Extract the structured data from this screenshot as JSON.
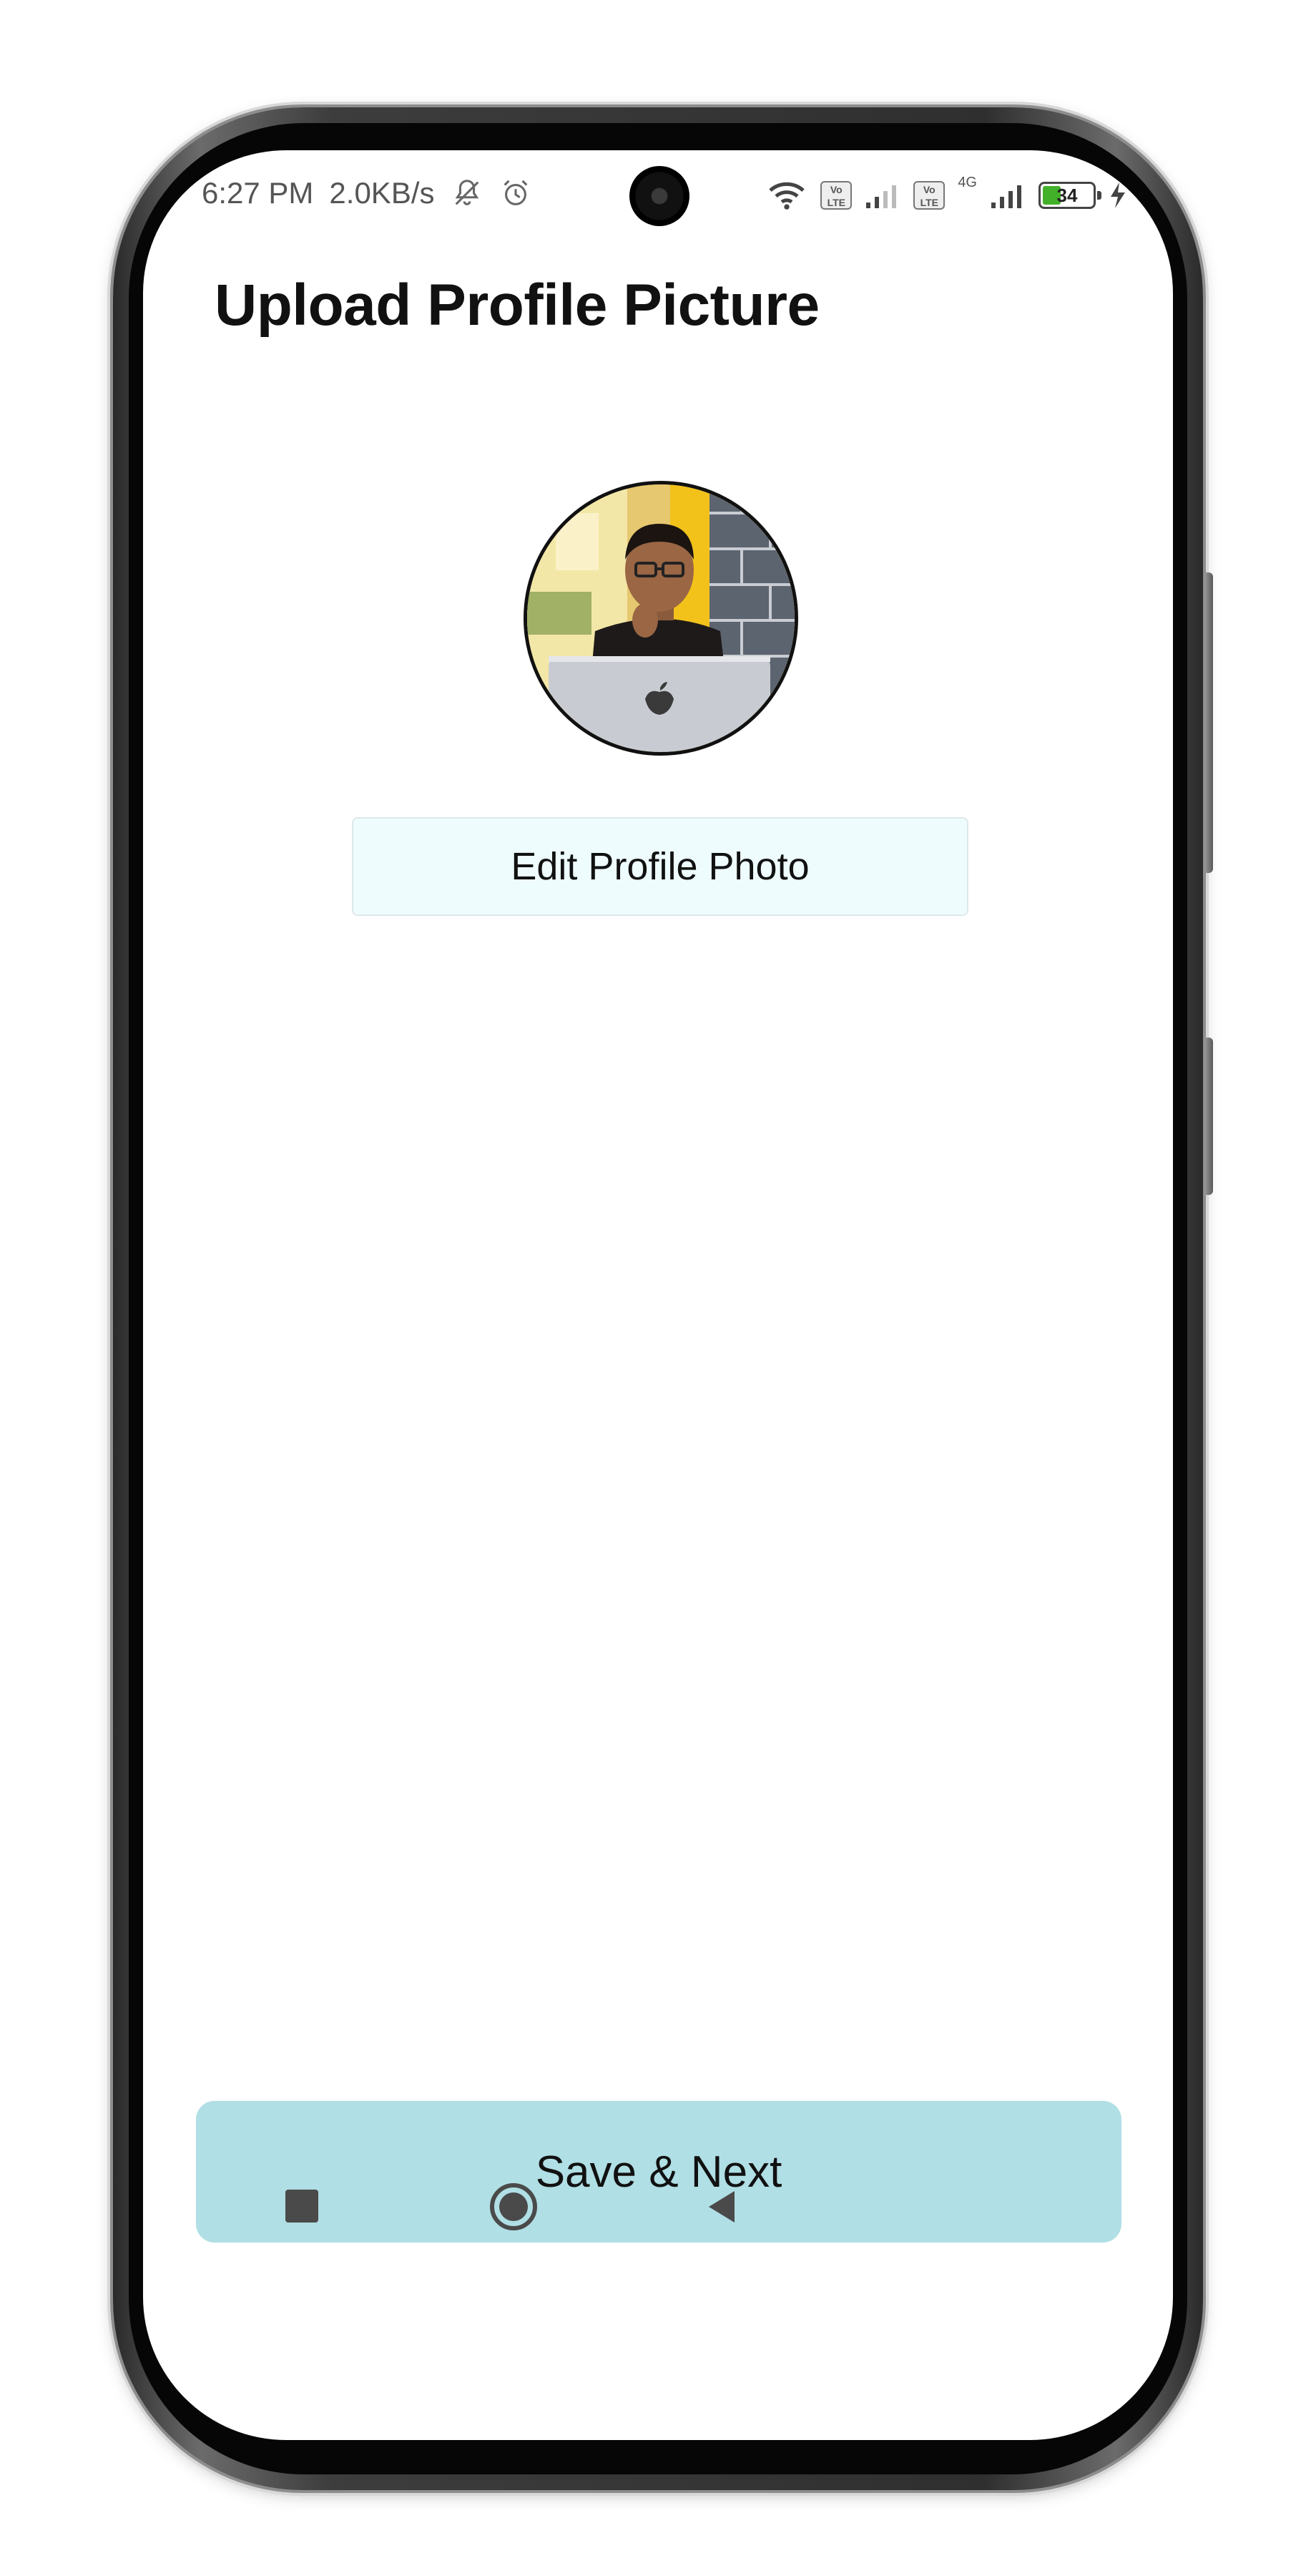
{
  "status_bar": {
    "time": "6:27 PM",
    "network_speed": "2.0KB/s",
    "battery_level": "34",
    "battery_fraction": 0.34,
    "network_label": "4G",
    "volte_label_1": "Vo LTE",
    "volte_label_2": "Vo LTE",
    "icons": [
      "mute-icon",
      "alarm-icon",
      "wifi-icon",
      "signal-icon",
      "charging-icon"
    ]
  },
  "page": {
    "title": "Upload Profile Picture"
  },
  "profile": {
    "edit_photo_label": "Edit Profile Photo"
  },
  "actions": {
    "save_next_label": "Save & Next"
  },
  "nav": {
    "icons": [
      "recents-icon",
      "home-icon",
      "back-icon"
    ]
  },
  "colors": {
    "save_button_bg": "#b0dfe5",
    "edit_button_bg": "#eefcfd",
    "title_color": "#111111"
  }
}
